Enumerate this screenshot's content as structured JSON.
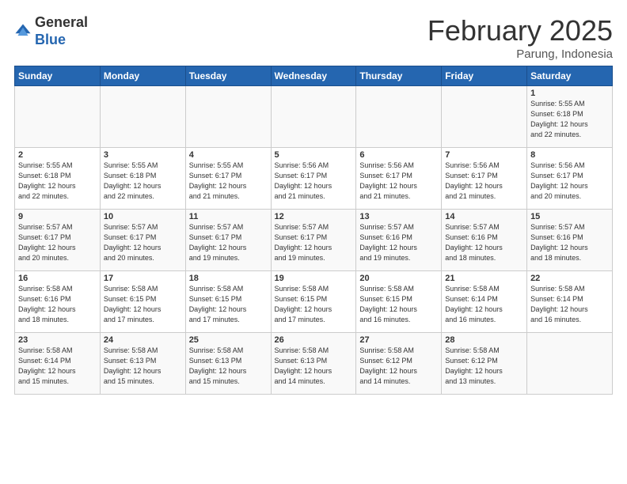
{
  "header": {
    "logo_general": "General",
    "logo_blue": "Blue",
    "title": "February 2025",
    "subtitle": "Parung, Indonesia"
  },
  "days_of_week": [
    "Sunday",
    "Monday",
    "Tuesday",
    "Wednesday",
    "Thursday",
    "Friday",
    "Saturday"
  ],
  "weeks": [
    [
      {
        "day": "",
        "info": ""
      },
      {
        "day": "",
        "info": ""
      },
      {
        "day": "",
        "info": ""
      },
      {
        "day": "",
        "info": ""
      },
      {
        "day": "",
        "info": ""
      },
      {
        "day": "",
        "info": ""
      },
      {
        "day": "1",
        "info": "Sunrise: 5:55 AM\nSunset: 6:18 PM\nDaylight: 12 hours\nand 22 minutes."
      }
    ],
    [
      {
        "day": "2",
        "info": "Sunrise: 5:55 AM\nSunset: 6:18 PM\nDaylight: 12 hours\nand 22 minutes."
      },
      {
        "day": "3",
        "info": "Sunrise: 5:55 AM\nSunset: 6:18 PM\nDaylight: 12 hours\nand 22 minutes."
      },
      {
        "day": "4",
        "info": "Sunrise: 5:55 AM\nSunset: 6:17 PM\nDaylight: 12 hours\nand 21 minutes."
      },
      {
        "day": "5",
        "info": "Sunrise: 5:56 AM\nSunset: 6:17 PM\nDaylight: 12 hours\nand 21 minutes."
      },
      {
        "day": "6",
        "info": "Sunrise: 5:56 AM\nSunset: 6:17 PM\nDaylight: 12 hours\nand 21 minutes."
      },
      {
        "day": "7",
        "info": "Sunrise: 5:56 AM\nSunset: 6:17 PM\nDaylight: 12 hours\nand 21 minutes."
      },
      {
        "day": "8",
        "info": "Sunrise: 5:56 AM\nSunset: 6:17 PM\nDaylight: 12 hours\nand 20 minutes."
      }
    ],
    [
      {
        "day": "9",
        "info": "Sunrise: 5:57 AM\nSunset: 6:17 PM\nDaylight: 12 hours\nand 20 minutes."
      },
      {
        "day": "10",
        "info": "Sunrise: 5:57 AM\nSunset: 6:17 PM\nDaylight: 12 hours\nand 20 minutes."
      },
      {
        "day": "11",
        "info": "Sunrise: 5:57 AM\nSunset: 6:17 PM\nDaylight: 12 hours\nand 19 minutes."
      },
      {
        "day": "12",
        "info": "Sunrise: 5:57 AM\nSunset: 6:17 PM\nDaylight: 12 hours\nand 19 minutes."
      },
      {
        "day": "13",
        "info": "Sunrise: 5:57 AM\nSunset: 6:16 PM\nDaylight: 12 hours\nand 19 minutes."
      },
      {
        "day": "14",
        "info": "Sunrise: 5:57 AM\nSunset: 6:16 PM\nDaylight: 12 hours\nand 18 minutes."
      },
      {
        "day": "15",
        "info": "Sunrise: 5:57 AM\nSunset: 6:16 PM\nDaylight: 12 hours\nand 18 minutes."
      }
    ],
    [
      {
        "day": "16",
        "info": "Sunrise: 5:58 AM\nSunset: 6:16 PM\nDaylight: 12 hours\nand 18 minutes."
      },
      {
        "day": "17",
        "info": "Sunrise: 5:58 AM\nSunset: 6:15 PM\nDaylight: 12 hours\nand 17 minutes."
      },
      {
        "day": "18",
        "info": "Sunrise: 5:58 AM\nSunset: 6:15 PM\nDaylight: 12 hours\nand 17 minutes."
      },
      {
        "day": "19",
        "info": "Sunrise: 5:58 AM\nSunset: 6:15 PM\nDaylight: 12 hours\nand 17 minutes."
      },
      {
        "day": "20",
        "info": "Sunrise: 5:58 AM\nSunset: 6:15 PM\nDaylight: 12 hours\nand 16 minutes."
      },
      {
        "day": "21",
        "info": "Sunrise: 5:58 AM\nSunset: 6:14 PM\nDaylight: 12 hours\nand 16 minutes."
      },
      {
        "day": "22",
        "info": "Sunrise: 5:58 AM\nSunset: 6:14 PM\nDaylight: 12 hours\nand 16 minutes."
      }
    ],
    [
      {
        "day": "23",
        "info": "Sunrise: 5:58 AM\nSunset: 6:14 PM\nDaylight: 12 hours\nand 15 minutes."
      },
      {
        "day": "24",
        "info": "Sunrise: 5:58 AM\nSunset: 6:13 PM\nDaylight: 12 hours\nand 15 minutes."
      },
      {
        "day": "25",
        "info": "Sunrise: 5:58 AM\nSunset: 6:13 PM\nDaylight: 12 hours\nand 15 minutes."
      },
      {
        "day": "26",
        "info": "Sunrise: 5:58 AM\nSunset: 6:13 PM\nDaylight: 12 hours\nand 14 minutes."
      },
      {
        "day": "27",
        "info": "Sunrise: 5:58 AM\nSunset: 6:12 PM\nDaylight: 12 hours\nand 14 minutes."
      },
      {
        "day": "28",
        "info": "Sunrise: 5:58 AM\nSunset: 6:12 PM\nDaylight: 12 hours\nand 13 minutes."
      },
      {
        "day": "",
        "info": ""
      }
    ]
  ]
}
